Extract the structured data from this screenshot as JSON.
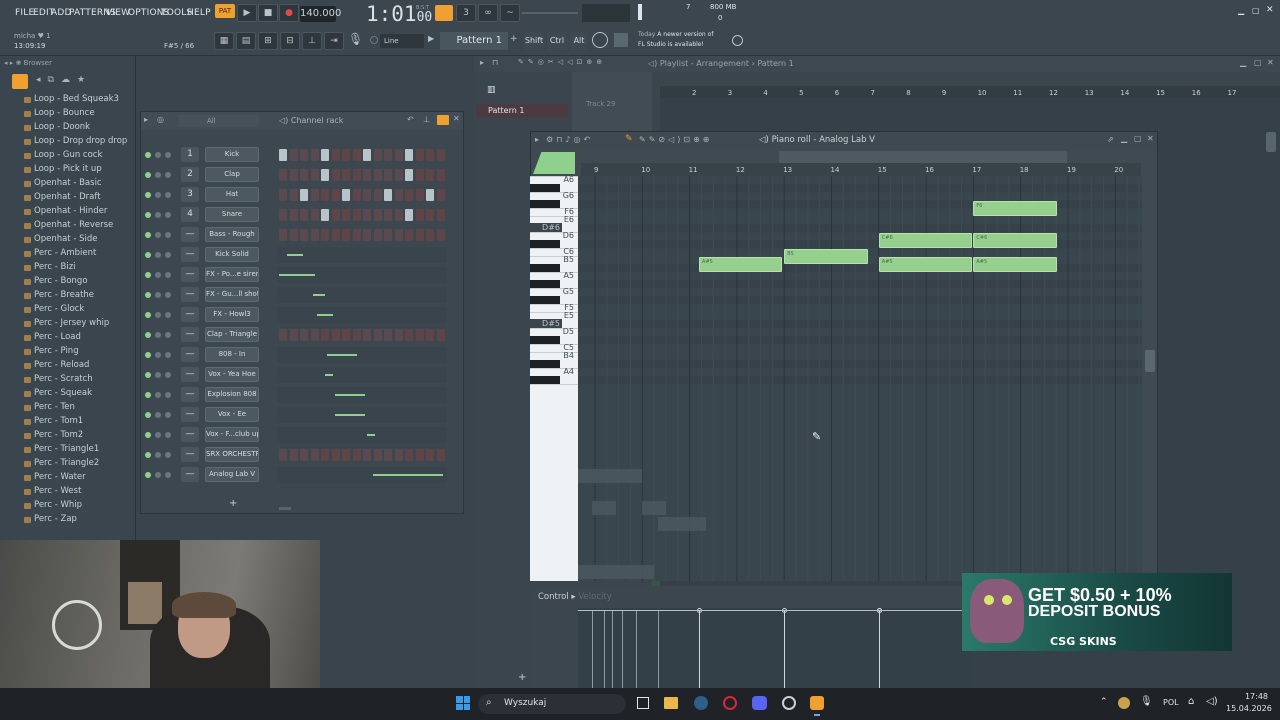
{
  "menu": [
    "FILE",
    "EDIT",
    "ADD",
    "PATTERNS",
    "VIEW",
    "OPTIONS",
    "TOOLS",
    "HELP"
  ],
  "topbar": {
    "pat_label": "PAT",
    "tempo": "140.000",
    "song_time": "1:01",
    "song_time_sub": "00",
    "bst": "B:S:T",
    "cpu_value": "7",
    "mem_value": "800 MB",
    "poly_value": "0",
    "user": "micha",
    "user_time": "13:09:19",
    "user_count": "1",
    "hint": "F#5 / 66",
    "snap": "Line",
    "pattern": "Pattern 1",
    "shift": "Shift",
    "ctrl": "Ctrl",
    "alt": "Alt",
    "news_day": "Today",
    "news_text": "A newer version of",
    "news_text2": "FL Studio is available!"
  },
  "browser": {
    "title": "Browser",
    "items": [
      "Loop - Bed Squeak3",
      "Loop - Bounce",
      "Loop - Doonk",
      "Loop - Drop drop drop",
      "Loop - Gun cock",
      "Loop - Pick it up",
      "Openhat - Basic",
      "Openhat - Draft",
      "Openhat - Hinder",
      "Openhat - Reverse",
      "Openhat - Side",
      "Perc - Ambient",
      "Perc - Bizi",
      "Perc - Bongo",
      "Perc - Breathe",
      "Perc - Glock",
      "Perc - Jersey whip",
      "Perc - Load",
      "Perc - Ping",
      "Perc - Reload",
      "Perc - Scratch",
      "Perc - Squeak",
      "Perc - Ten",
      "Perc - Tom1",
      "Perc - Tom2",
      "Perc - Triangle1",
      "Perc - Triangle2",
      "Perc - Water",
      "Perc - West",
      "Perc - Whip",
      "Perc - Zap"
    ]
  },
  "channel_rack": {
    "title": "Channel rack",
    "filter": "All",
    "add_label": "+",
    "channels": [
      {
        "num": "1",
        "name": "Kick"
      },
      {
        "num": "2",
        "name": "Clap"
      },
      {
        "num": "3",
        "name": "Hat"
      },
      {
        "num": "4",
        "name": "Snare"
      },
      {
        "num": "—",
        "name": "Bass - Rough"
      },
      {
        "num": "—",
        "name": "Kick Solid"
      },
      {
        "num": "—",
        "name": "FX - Po...e siren"
      },
      {
        "num": "—",
        "name": "FX - Gu...ll shot"
      },
      {
        "num": "—",
        "name": "FX - Howl3"
      },
      {
        "num": "—",
        "name": "Clap - Triangle"
      },
      {
        "num": "—",
        "name": "808 - In"
      },
      {
        "num": "—",
        "name": "Vox - Yea Hoe"
      },
      {
        "num": "—",
        "name": "Explosion 808"
      },
      {
        "num": "—",
        "name": "Vox - Ee"
      },
      {
        "num": "—",
        "name": "Vox - F...club up"
      },
      {
        "num": "—",
        "name": "SRX ORCHESTRA"
      },
      {
        "num": "—",
        "name": "Analog Lab V"
      }
    ]
  },
  "playlist": {
    "title": "Playlist - Arrangement",
    "pattern": "Pattern 1",
    "pattern_item": "Pattern 1",
    "track": "Track 29",
    "bars": [
      "2",
      "3",
      "4",
      "5",
      "6",
      "7",
      "8",
      "9",
      "10",
      "11",
      "12",
      "13",
      "14",
      "15",
      "16",
      "17"
    ]
  },
  "piano_roll": {
    "title": "Piano roll - Analog Lab V",
    "bars": [
      "9",
      "10",
      "11",
      "12",
      "13",
      "14",
      "15",
      "16",
      "17",
      "18",
      "19",
      "20"
    ],
    "keys": [
      "A6",
      "G6",
      "F6",
      "E6",
      "D#6",
      "D6",
      "C6",
      "B5",
      "A5",
      "G5",
      "F5",
      "E5",
      "D#5",
      "D5",
      "C5",
      "B4",
      "A4"
    ],
    "notes": [
      {
        "label": "F6",
        "pitch": "F6",
        "start": 17,
        "len": 1.8
      },
      {
        "label": "C#6",
        "pitch": "C#6",
        "start": 15,
        "len": 2
      },
      {
        "label": "C#6",
        "pitch": "C#6",
        "start": 17,
        "len": 1.8
      },
      {
        "label": "B5",
        "pitch": "B5",
        "start": 13,
        "len": 1.8
      },
      {
        "label": "A#5",
        "pitch": "A#5",
        "start": 11.2,
        "len": 1.8
      },
      {
        "label": "A#5",
        "pitch": "A#5",
        "start": 15,
        "len": 2
      },
      {
        "label": "A#5",
        "pitch": "A#5",
        "start": 17,
        "len": 1.8
      }
    ],
    "control_label": "Control",
    "velocity_label": "Velocity"
  },
  "ad": {
    "line1": "GET $0.50 + 10%",
    "line2": "DEPOSIT BONUS",
    "brand": "CSG SKINS"
  },
  "taskbar": {
    "search_placeholder": "Wyszukaj",
    "lang": "POL",
    "time": "17:48",
    "date": "15.04.2026"
  },
  "colors": {
    "note_green": "#96d08e",
    "accent_orange": "#f0a030",
    "bg": "#3a454d"
  }
}
